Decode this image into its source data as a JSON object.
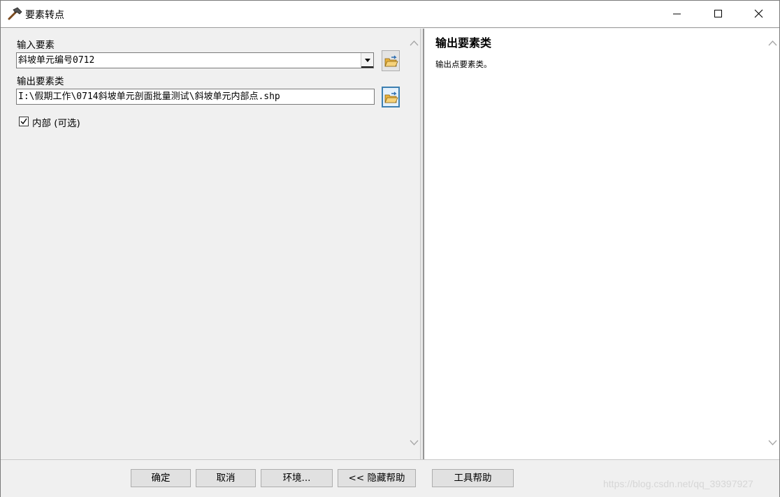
{
  "window": {
    "title": "要素转点",
    "controls": {
      "minimize": "minimize-icon",
      "maximize": "maximize-icon",
      "close": "close-icon"
    }
  },
  "form": {
    "input_label": "输入要素",
    "input_value": "斜坡单元编号0712",
    "output_label": "输出要素类",
    "output_value": "I:\\假期工作\\0714斜坡单元剖面批量测试\\斜坡单元内部点.shp",
    "inside_label": "内部 (可选)",
    "inside_checked": true
  },
  "help": {
    "title": "输出要素类",
    "text": "输出点要素类。"
  },
  "buttons": {
    "ok": "确定",
    "cancel": "取消",
    "env": "环境...",
    "hide_help": "<< 隐藏帮助",
    "tool_help": "工具帮助"
  },
  "watermark": "https://blog.csdn.net/qq_39397927",
  "colors": {
    "focus_border": "#3c7fb1",
    "folder_yellow": "#f2c14e",
    "arrow_blue": "#2b6cb0"
  }
}
